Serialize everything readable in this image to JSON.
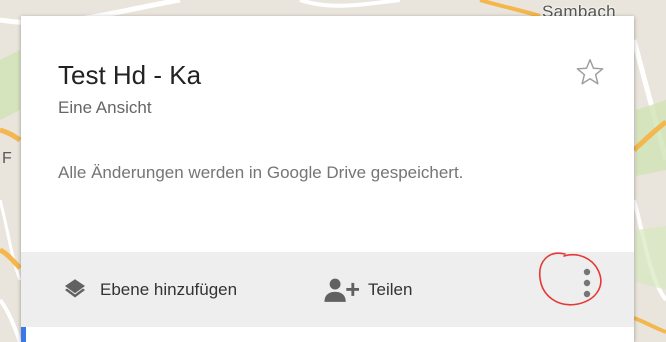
{
  "map": {
    "place_label": "Sambach",
    "edge_letter": "F"
  },
  "panel": {
    "title": "Test Hd - Ka",
    "subtitle": "Eine Ansicht",
    "status": "Alle Änderungen werden in Google Drive gespeichert."
  },
  "toolbar": {
    "add_layer_label": "Ebene hinzufügen",
    "share_label": "Teilen"
  },
  "icons": {
    "star": "star-outline-icon",
    "layers": "layers-icon",
    "add_person": "person-add-icon",
    "more": "more-vertical-icon"
  },
  "colors": {
    "map_background": "#e9e5dc",
    "map_road_primary": "#f4b74d",
    "panel_background": "#ffffff",
    "toolbar_background": "#eeeeee",
    "annotation_circle": "#e53935",
    "accent": "#3b78e7"
  }
}
